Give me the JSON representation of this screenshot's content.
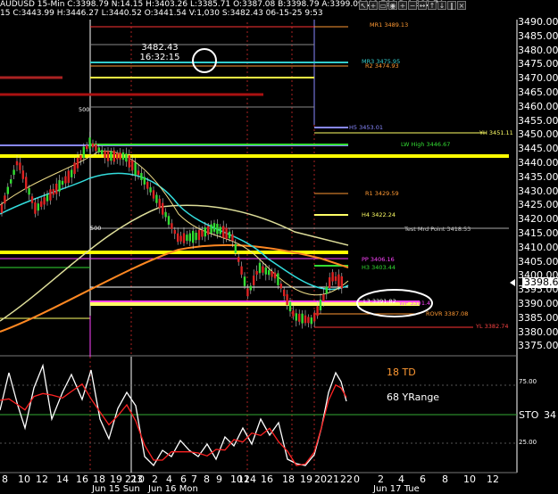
{
  "header": {
    "line1": "AUDUSD 15-Min C:3398.79 N:14.15 H:3403.26 L:3385.71 O:3387.08 B:3398.79 A:3399.09 V:9,790 D:1,382.74",
    "line2": "15 C:3443.99 H:3446.27 L:3440.52 O:3441.54 V:1,030 S:3482.43 06-15-25 9:53",
    "toolbar_icons": [
      "arrow-icon",
      "crosshair-icon",
      "ticket-icon",
      "eye-icon",
      "plus-icon",
      "minus-icon",
      "drag-icon",
      "up-icon",
      "down-icon",
      "pause-icon",
      "close-icon"
    ]
  },
  "cursor_tooltip": {
    "price": "3482.43",
    "time": "16:32:15"
  },
  "price_labels": [
    "3490.00",
    "3485.00",
    "3480.00",
    "3475.00",
    "3470.00",
    "3465.00",
    "3460.00",
    "3455.00",
    "3450.00",
    "3445.00",
    "3440.00",
    "3435.00",
    "3430.00",
    "3425.00",
    "3420.00",
    "3415.00",
    "3410.00",
    "3405.00",
    "3400.00",
    "3395.00",
    "3390.00",
    "3385.00",
    "3380.00",
    "3375.00"
  ],
  "current_price": "3398.62",
  "level_labels": [
    {
      "text": "MR1 3489.13",
      "color": "#ff9933"
    },
    {
      "text": "MR3 3475.95",
      "color": "#33cccc"
    },
    {
      "text": "R2 3474.93",
      "color": "#ff9933"
    },
    {
      "text": "H5 3453.01",
      "color": "#8888ff"
    },
    {
      "text": "YH 3451.11",
      "color": "#ffff66"
    },
    {
      "text": "LW High 3446.67",
      "color": "#33dd33"
    },
    {
      "text": "R1 3429.59",
      "color": "#ff9933"
    },
    {
      "text": "H4 3422.24",
      "color": "#ffff66"
    },
    {
      "text": "Test Mrd Point 3418.53",
      "color": "#cccccc"
    },
    {
      "text": "PP 3406.16",
      "color": "#ff44ff"
    },
    {
      "text": "H3 3403.44",
      "color": "#33dd33"
    },
    {
      "text": "L3 3391.82",
      "color": "#ffffff"
    },
    {
      "text": "WP 3391.4",
      "color": "#ff44ff"
    },
    {
      "text": "ROVR 3387.08",
      "color": "#ff9933"
    },
    {
      "text": "YL 3382.74",
      "color": "#ff4444"
    }
  ],
  "chart_marks": {
    "left_500_top": "500",
    "left_500_mid": "500"
  },
  "indicator": {
    "td_label": "18 TD",
    "range_label": "68 YRange",
    "sto_label": "STO",
    "sto_value": "34",
    "levels": [
      "75.00",
      "25.00"
    ]
  },
  "time_labels": [
    "8",
    "10",
    "12",
    "14",
    "16",
    "18",
    "19",
    "21",
    "23",
    "0",
    "2",
    "4",
    "6",
    "7",
    "8",
    "9",
    "10",
    "12",
    "14",
    "16",
    "18",
    "19",
    "20",
    "21",
    "22",
    "0",
    "2",
    "4",
    "6",
    "8",
    "10",
    "12"
  ],
  "date_labels": [
    "Jun 15 Sun",
    "Jun 16 Mon",
    "Jun 17 Tue"
  ],
  "colors": {
    "price_axis": "#ffffff",
    "cursor_circle": "#ffffff",
    "sto_line": "#ffffff",
    "sto_signal": "#ff2222"
  }
}
